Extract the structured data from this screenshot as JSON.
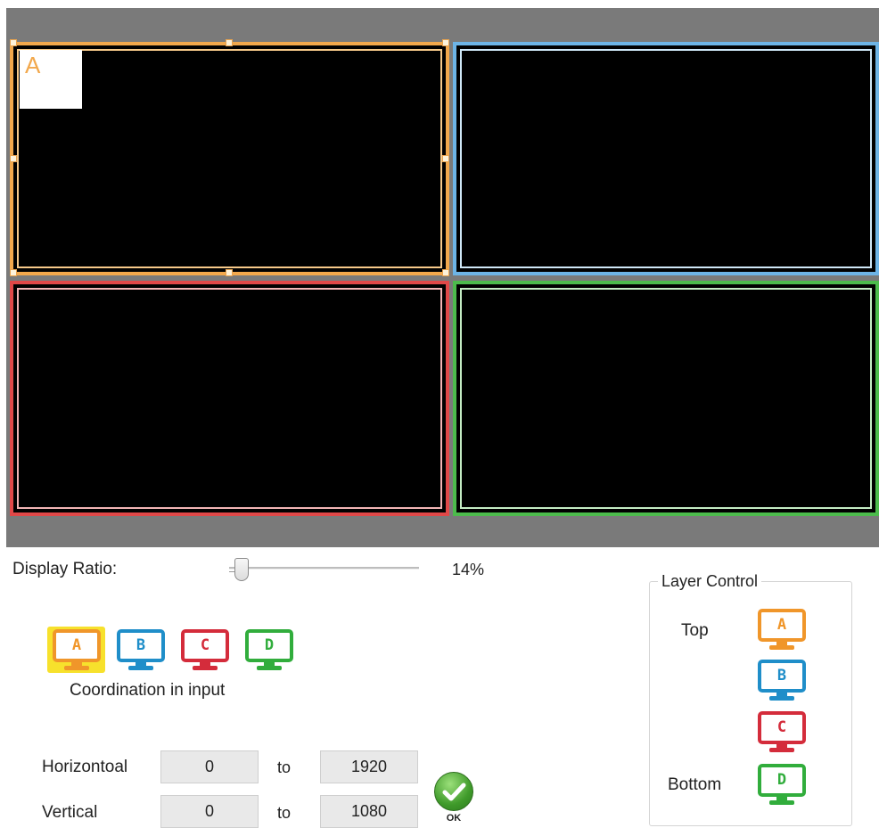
{
  "preview": {
    "windows": [
      {
        "id": "A",
        "label": "A",
        "color": "#f2a84c"
      },
      {
        "id": "B",
        "color": "#6db4e6"
      },
      {
        "id": "C",
        "color": "#e04848"
      },
      {
        "id": "D",
        "color": "#4cbb4c"
      }
    ]
  },
  "display_ratio": {
    "label": "Display Ratio:",
    "value": "14%",
    "percent": 14
  },
  "inputs": {
    "items": [
      {
        "letter": "A",
        "color": "#f0962a",
        "selected": true
      },
      {
        "letter": "B",
        "color": "#1f8ec9",
        "selected": false
      },
      {
        "letter": "C",
        "color": "#d42c3b",
        "selected": false
      },
      {
        "letter": "D",
        "color": "#31ad3c",
        "selected": false
      }
    ],
    "caption": "Coordination in input"
  },
  "coordinates": {
    "horizontal": {
      "label": "Horizontoal",
      "from": "0",
      "to_label": "to",
      "to": "1920"
    },
    "vertical": {
      "label": "Vertical",
      "from": "0",
      "to_label": "to",
      "to": "1080"
    },
    "ok_label": "OK"
  },
  "layer_control": {
    "title": "Layer Control",
    "top_label": "Top",
    "bottom_label": "Bottom",
    "order": [
      "A",
      "B",
      "C",
      "D"
    ]
  },
  "icons": {
    "monitor": "monitor-icon",
    "ok": "checkmark-icon"
  }
}
